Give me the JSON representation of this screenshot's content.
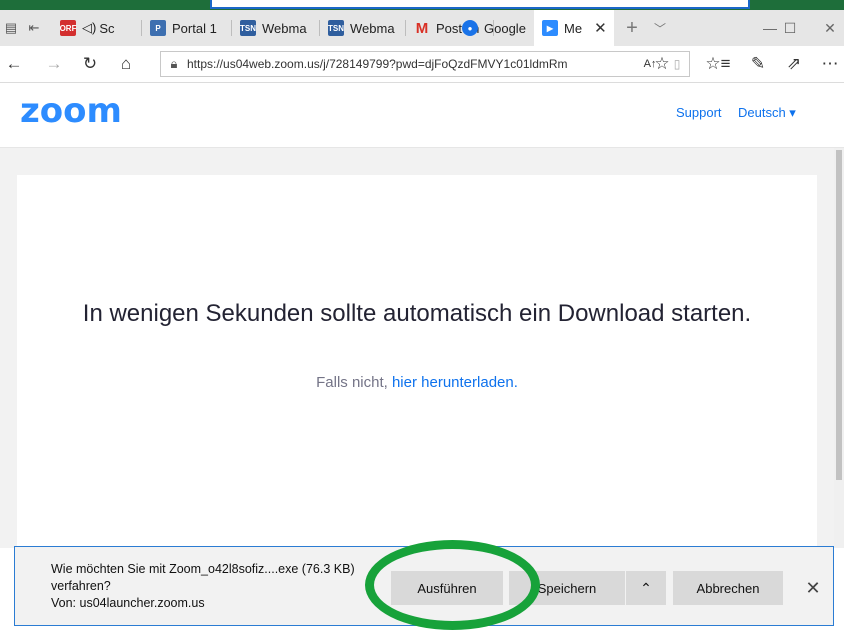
{
  "browser": {
    "tabs": [
      {
        "label": "Sc",
        "icon": "speaker-icon"
      },
      {
        "label": "Portal 1",
        "icon": "portal-icon"
      },
      {
        "label": "Webma",
        "icon": "tsn-icon"
      },
      {
        "label": "Webma",
        "icon": "tsn-icon"
      },
      {
        "label": "Postein",
        "icon": "gmail-icon"
      },
      {
        "label": "Google",
        "icon": "google-account-icon"
      },
      {
        "label": "Me",
        "icon": "zoom-icon"
      }
    ],
    "url": "https://us04web.zoom.us/j/728149799?pwd=djFoQzdFMVY1c01ldmRm"
  },
  "header": {
    "logo": "zoom",
    "support": "Support",
    "language": "Deutsch ▾"
  },
  "main": {
    "headline": "In wenigen Sekunden sollte automatisch ein Download starten.",
    "fallback_prefix": "Falls nicht, ",
    "fallback_link": "hier herunterladen."
  },
  "download_bar": {
    "line1": "Wie möchten Sie mit Zoom_o42l8sofiz....exe (76.3 KB)",
    "line2": "verfahren?",
    "line3": "Von: us04launcher.zoom.us",
    "run": "Ausführen",
    "save": "Speichern",
    "cancel": "Abbrechen"
  },
  "colors": {
    "zoom_blue": "#2d8cff",
    "highlight_ring": "#17a23a",
    "download_border": "#2b7cd3"
  }
}
